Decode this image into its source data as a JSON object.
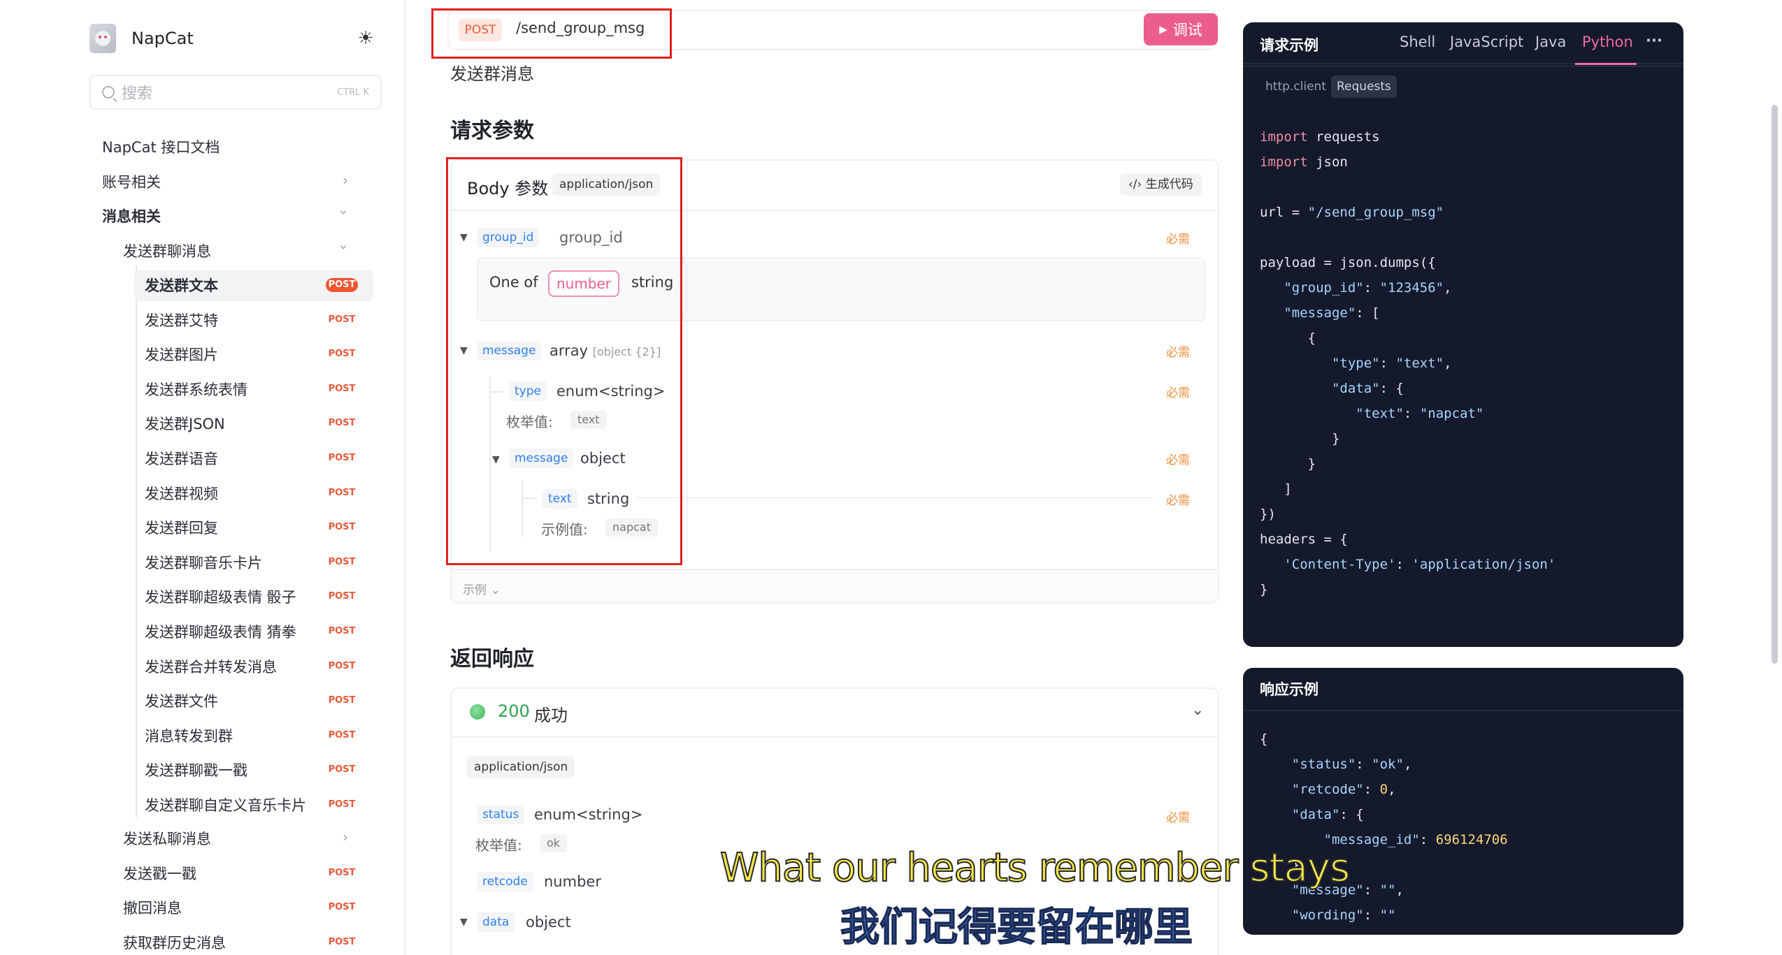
{
  "sidebar": {
    "app_name": "NapCat",
    "search_placeholder": "搜索",
    "search_shortcut": "CTRL K",
    "items": [
      {
        "label": "NapCat 接口文档"
      },
      {
        "label": "账号相关"
      },
      {
        "label": "消息相关"
      },
      {
        "label": "发送群聊消息"
      }
    ],
    "endpoints": [
      {
        "label": "发送群文本",
        "method": "POST"
      },
      {
        "label": "发送群艾特",
        "method": "POST"
      },
      {
        "label": "发送群图片",
        "method": "POST"
      },
      {
        "label": "发送群系统表情",
        "method": "POST"
      },
      {
        "label": "发送群JSON",
        "method": "POST"
      },
      {
        "label": "发送群语音",
        "method": "POST"
      },
      {
        "label": "发送群视频",
        "method": "POST"
      },
      {
        "label": "发送群回复",
        "method": "POST"
      },
      {
        "label": "发送群聊音乐卡片",
        "method": "POST"
      },
      {
        "label": "发送群聊超级表情 骰子",
        "method": "POST"
      },
      {
        "label": "发送群聊超级表情 猜拳",
        "method": "POST"
      },
      {
        "label": "发送群合并转发消息",
        "method": "POST"
      },
      {
        "label": "发送群文件",
        "method": "POST"
      },
      {
        "label": "消息转发到群",
        "method": "POST"
      },
      {
        "label": "发送群聊戳一戳",
        "method": "POST"
      },
      {
        "label": "发送群聊自定义音乐卡片",
        "method": "POST"
      }
    ],
    "more": [
      {
        "label": "发送私聊消息"
      },
      {
        "label": "发送戳一戳",
        "method": "POST"
      },
      {
        "label": "撤回消息",
        "method": "POST"
      },
      {
        "label": "获取群历史消息",
        "method": "POST"
      }
    ]
  },
  "endpoint": {
    "method": "POST",
    "path": "/send_group_msg",
    "debug_label": "调试",
    "description": "发送群消息"
  },
  "request": {
    "title": "请求参数",
    "body_label": "Body 参数",
    "content_type": "application/json",
    "gen_code": "生成代码",
    "required_label": "必需",
    "fields": {
      "group_id": {
        "name": "group_id",
        "type": "group_id"
      },
      "oneof_label": "One of",
      "oneof_a": "number",
      "oneof_b": "string",
      "message": {
        "name": "message",
        "type": "array",
        "type_extra": "[object {2}]"
      },
      "type": {
        "name": "type",
        "type": "enum<string>",
        "enum_label": "枚举值:",
        "enum_value": "text"
      },
      "message_obj": {
        "name": "message",
        "type": "object"
      },
      "text": {
        "name": "text",
        "type": "string",
        "example_label": "示例值:",
        "example_value": "napcat"
      }
    },
    "example_toggle": "示例"
  },
  "response": {
    "title": "返回响应",
    "status_code": "200",
    "status_text": "成功",
    "content_type": "application/json",
    "fields": {
      "status": {
        "name": "status",
        "type": "enum<string>",
        "enum_label": "枚举值:",
        "enum_value": "ok"
      },
      "retcode": {
        "name": "retcode",
        "type": "number"
      },
      "data": {
        "name": "data",
        "type": "object"
      }
    }
  },
  "request_example": {
    "title": "请求示例",
    "tabs": [
      "Shell",
      "JavaScript",
      "Java",
      "Python"
    ],
    "active_tab": "Python",
    "more_label": "···",
    "sub_tabs": [
      "http.client",
      "Requests"
    ],
    "active_sub_tab": "Requests"
  },
  "response_example": {
    "title": "响应示例"
  },
  "subtitles": {
    "english": "What our hearts remember stays",
    "chinese": "我们记得要留在哪里"
  },
  "colors": {
    "accent": "#ec5d8d",
    "post": "#ea5a34",
    "code_bg": "#141a2b",
    "highlight_box": "#e02020"
  }
}
